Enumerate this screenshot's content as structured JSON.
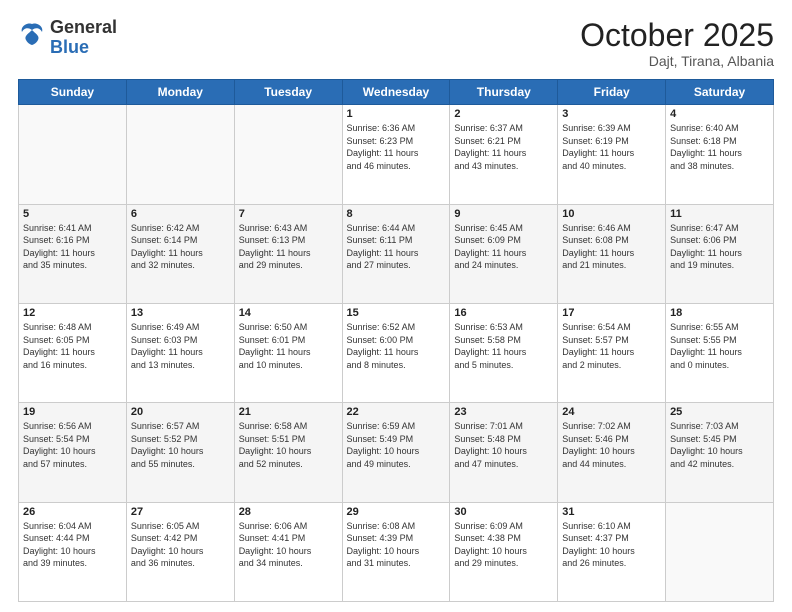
{
  "header": {
    "logo_general": "General",
    "logo_blue": "Blue",
    "month_title": "October 2025",
    "location": "Dajt, Tirana, Albania"
  },
  "days_of_week": [
    "Sunday",
    "Monday",
    "Tuesday",
    "Wednesday",
    "Thursday",
    "Friday",
    "Saturday"
  ],
  "weeks": [
    [
      {
        "day": "",
        "info": ""
      },
      {
        "day": "",
        "info": ""
      },
      {
        "day": "",
        "info": ""
      },
      {
        "day": "1",
        "info": "Sunrise: 6:36 AM\nSunset: 6:23 PM\nDaylight: 11 hours\nand 46 minutes."
      },
      {
        "day": "2",
        "info": "Sunrise: 6:37 AM\nSunset: 6:21 PM\nDaylight: 11 hours\nand 43 minutes."
      },
      {
        "day": "3",
        "info": "Sunrise: 6:39 AM\nSunset: 6:19 PM\nDaylight: 11 hours\nand 40 minutes."
      },
      {
        "day": "4",
        "info": "Sunrise: 6:40 AM\nSunset: 6:18 PM\nDaylight: 11 hours\nand 38 minutes."
      }
    ],
    [
      {
        "day": "5",
        "info": "Sunrise: 6:41 AM\nSunset: 6:16 PM\nDaylight: 11 hours\nand 35 minutes."
      },
      {
        "day": "6",
        "info": "Sunrise: 6:42 AM\nSunset: 6:14 PM\nDaylight: 11 hours\nand 32 minutes."
      },
      {
        "day": "7",
        "info": "Sunrise: 6:43 AM\nSunset: 6:13 PM\nDaylight: 11 hours\nand 29 minutes."
      },
      {
        "day": "8",
        "info": "Sunrise: 6:44 AM\nSunset: 6:11 PM\nDaylight: 11 hours\nand 27 minutes."
      },
      {
        "day": "9",
        "info": "Sunrise: 6:45 AM\nSunset: 6:09 PM\nDaylight: 11 hours\nand 24 minutes."
      },
      {
        "day": "10",
        "info": "Sunrise: 6:46 AM\nSunset: 6:08 PM\nDaylight: 11 hours\nand 21 minutes."
      },
      {
        "day": "11",
        "info": "Sunrise: 6:47 AM\nSunset: 6:06 PM\nDaylight: 11 hours\nand 19 minutes."
      }
    ],
    [
      {
        "day": "12",
        "info": "Sunrise: 6:48 AM\nSunset: 6:05 PM\nDaylight: 11 hours\nand 16 minutes."
      },
      {
        "day": "13",
        "info": "Sunrise: 6:49 AM\nSunset: 6:03 PM\nDaylight: 11 hours\nand 13 minutes."
      },
      {
        "day": "14",
        "info": "Sunrise: 6:50 AM\nSunset: 6:01 PM\nDaylight: 11 hours\nand 10 minutes."
      },
      {
        "day": "15",
        "info": "Sunrise: 6:52 AM\nSunset: 6:00 PM\nDaylight: 11 hours\nand 8 minutes."
      },
      {
        "day": "16",
        "info": "Sunrise: 6:53 AM\nSunset: 5:58 PM\nDaylight: 11 hours\nand 5 minutes."
      },
      {
        "day": "17",
        "info": "Sunrise: 6:54 AM\nSunset: 5:57 PM\nDaylight: 11 hours\nand 2 minutes."
      },
      {
        "day": "18",
        "info": "Sunrise: 6:55 AM\nSunset: 5:55 PM\nDaylight: 11 hours\nand 0 minutes."
      }
    ],
    [
      {
        "day": "19",
        "info": "Sunrise: 6:56 AM\nSunset: 5:54 PM\nDaylight: 10 hours\nand 57 minutes."
      },
      {
        "day": "20",
        "info": "Sunrise: 6:57 AM\nSunset: 5:52 PM\nDaylight: 10 hours\nand 55 minutes."
      },
      {
        "day": "21",
        "info": "Sunrise: 6:58 AM\nSunset: 5:51 PM\nDaylight: 10 hours\nand 52 minutes."
      },
      {
        "day": "22",
        "info": "Sunrise: 6:59 AM\nSunset: 5:49 PM\nDaylight: 10 hours\nand 49 minutes."
      },
      {
        "day": "23",
        "info": "Sunrise: 7:01 AM\nSunset: 5:48 PM\nDaylight: 10 hours\nand 47 minutes."
      },
      {
        "day": "24",
        "info": "Sunrise: 7:02 AM\nSunset: 5:46 PM\nDaylight: 10 hours\nand 44 minutes."
      },
      {
        "day": "25",
        "info": "Sunrise: 7:03 AM\nSunset: 5:45 PM\nDaylight: 10 hours\nand 42 minutes."
      }
    ],
    [
      {
        "day": "26",
        "info": "Sunrise: 6:04 AM\nSunset: 4:44 PM\nDaylight: 10 hours\nand 39 minutes."
      },
      {
        "day": "27",
        "info": "Sunrise: 6:05 AM\nSunset: 4:42 PM\nDaylight: 10 hours\nand 36 minutes."
      },
      {
        "day": "28",
        "info": "Sunrise: 6:06 AM\nSunset: 4:41 PM\nDaylight: 10 hours\nand 34 minutes."
      },
      {
        "day": "29",
        "info": "Sunrise: 6:08 AM\nSunset: 4:39 PM\nDaylight: 10 hours\nand 31 minutes."
      },
      {
        "day": "30",
        "info": "Sunrise: 6:09 AM\nSunset: 4:38 PM\nDaylight: 10 hours\nand 29 minutes."
      },
      {
        "day": "31",
        "info": "Sunrise: 6:10 AM\nSunset: 4:37 PM\nDaylight: 10 hours\nand 26 minutes."
      },
      {
        "day": "",
        "info": ""
      }
    ]
  ]
}
